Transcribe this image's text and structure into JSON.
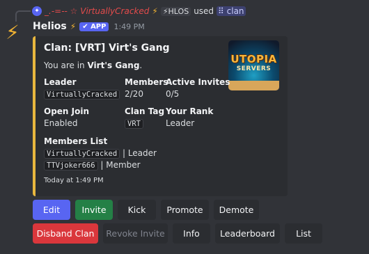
{
  "reply": {
    "avatar_glyph": "✦",
    "username": "_.-=-- ☆ VirtuallyCracked",
    "bolt": "⚡",
    "tag": "⚡HLOS",
    "used_text": "used",
    "command": "⠿ clan"
  },
  "message": {
    "bot_name": "Helios",
    "bolt": "⚡",
    "app_badge": "✔ APP",
    "time": "1:49 PM",
    "avatar_glyph": "⚡"
  },
  "embed": {
    "accent_color": "#e8b73e",
    "title": "Clan: [VRT] Virt's Gang",
    "desc_prefix": "You are in ",
    "desc_clan": "Virt's Gang",
    "desc_suffix": ".",
    "thumbnail": {
      "line1": "UTOPIA",
      "line2": "SERVERS"
    },
    "fields": {
      "leader": {
        "name": "Leader",
        "value": "VirtuallyCracked"
      },
      "members": {
        "name": "Members",
        "value": "2/20"
      },
      "active_invites": {
        "name": "Active Invites",
        "value": "0/5"
      },
      "open_join": {
        "name": "Open Join",
        "value": "Enabled"
      },
      "clan_tag": {
        "name": "Clan Tag",
        "value": "VRT"
      },
      "your_rank": {
        "name": "Your Rank",
        "value": "Leader"
      }
    },
    "members_list": {
      "name": "Members List",
      "rows": [
        {
          "user": "VirtuallyCracked",
          "role": " | Leader"
        },
        {
          "user": "TTVjoker666",
          "role": " | Member"
        }
      ]
    },
    "footer": "Today at 1:49 PM"
  },
  "buttons": {
    "row1": {
      "edit": "Edit",
      "invite": "Invite",
      "kick": "Kick",
      "promote": "Promote",
      "demote": "Demote"
    },
    "row2": {
      "disband": "Disband Clan",
      "revoke": "Revoke Invite",
      "info": "Info",
      "leaderboard": "Leaderboard",
      "list": "List"
    }
  }
}
